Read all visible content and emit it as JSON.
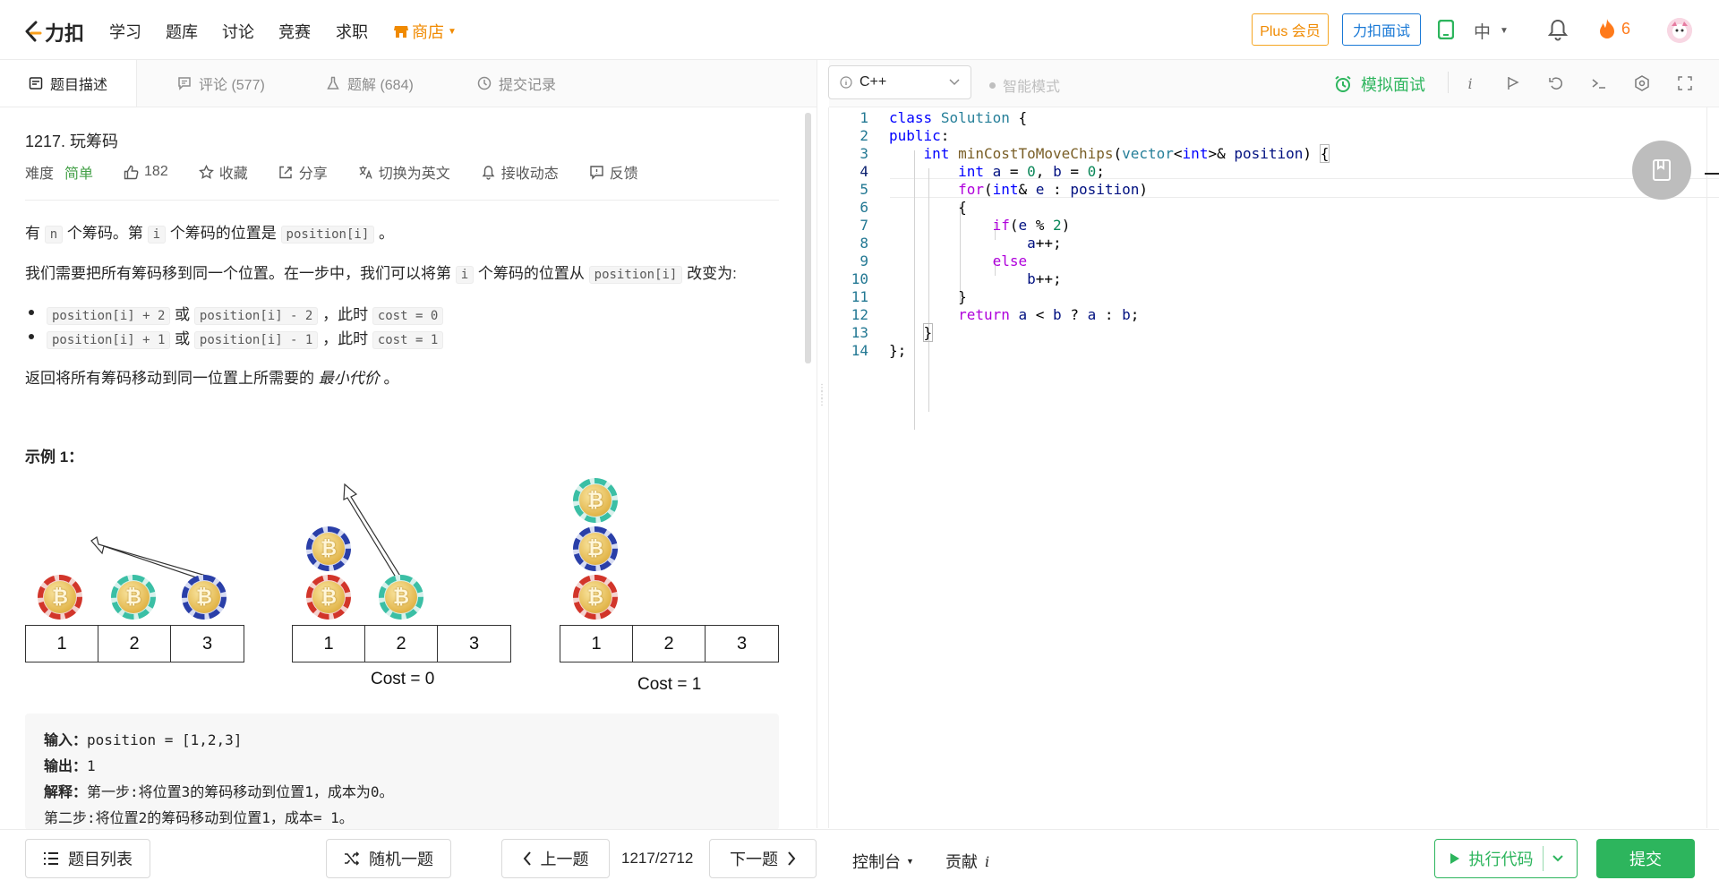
{
  "nav": {
    "logo_text": "力扣",
    "items": [
      "学习",
      "题库",
      "讨论",
      "竞赛",
      "求职"
    ],
    "shop": "商店",
    "plus": "Plus 会员",
    "interview": "力扣面试",
    "lang": "中",
    "streak": "6"
  },
  "tabs": [
    {
      "label": "题目描述"
    },
    {
      "label": "评论 (577)"
    },
    {
      "label": "题解 (684)"
    },
    {
      "label": "提交记录"
    }
  ],
  "problem": {
    "title": "1217. 玩筹码",
    "difficulty_label": "难度",
    "difficulty": "简单",
    "likes": "182",
    "favorite": "收藏",
    "share": "分享",
    "switch_lang": "切换为英文",
    "subscribe": "接收动态",
    "feedback": "反馈",
    "p1": {
      "a": "有",
      "code1": "n",
      "b": "个筹码。第",
      "code2": "i",
      "c": "个筹码的位置是",
      "code3": "position[i]",
      "d": "。"
    },
    "p2": {
      "a": "我们需要把所有筹码移到同一个位置。在一步中，我们可以将第",
      "code1": "i",
      "b": "个筹码的位置从",
      "code2": "position[i]",
      "c": "改变为:"
    },
    "bullets": [
      {
        "c1": "position[i] + 2",
        "or": "或",
        "c2": "position[i] - 2",
        "sep": "，此时",
        "c3": "cost = 0"
      },
      {
        "c1": "position[i] + 1",
        "or": "或",
        "c2": "position[i] - 1",
        "sep": "，此时",
        "c3": "cost = 1"
      }
    ],
    "p3": {
      "a": "返回将所有筹码移动到同一位置上所需要的",
      "em": "最小代价",
      "b": "。"
    },
    "example_title": "示例 1：",
    "figure": {
      "cells": [
        "1",
        "2",
        "3"
      ],
      "cost0": "Cost = 0",
      "cost1": "Cost = 1"
    },
    "example": {
      "input_label": "输入：",
      "input": "position = [1,2,3]",
      "output_label": "输出：",
      "output": "1",
      "explain_label": "解释：",
      "explain1": "第一步:将位置3的筹码移动到位置1，成本为0。",
      "explain2": "第二步:将位置2的筹码移动到位置1，成本= 1。"
    }
  },
  "editor": {
    "language": "C++",
    "smart_mode": "智能模式",
    "mock_interview": "模拟面试",
    "line_numbers": [
      "1",
      "2",
      "3",
      "4",
      "5",
      "6",
      "7",
      "8",
      "9",
      "10",
      "11",
      "12",
      "13",
      "14"
    ],
    "current_line": 4
  },
  "bottom": {
    "problem_list": "题目列表",
    "random": "随机一题",
    "prev": "上一题",
    "pager": "1217/2712",
    "next": "下一题",
    "console": "控制台",
    "contribute": "贡献",
    "run": "执行代码",
    "submit": "提交"
  },
  "colors": {
    "accent_green": "#2db55d",
    "accent_orange": "#f08a00",
    "accent_blue": "#1a79d6"
  }
}
